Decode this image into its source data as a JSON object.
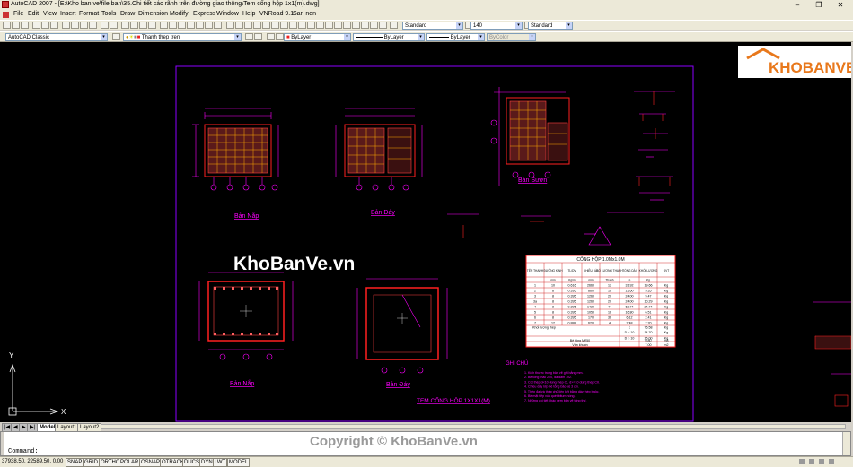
{
  "titlebar": {
    "title": "AutoCAD 2007 - [E:\\Kho ban ve\\file ban\\35.Chi tiết các rãnh trên đường giao thông\\Tem cống hộp 1x1(m).dwg]",
    "minimize_glyph": "–",
    "restore_glyph": "❐",
    "close_glyph": "✕"
  },
  "menubar": {
    "items": [
      "File",
      "Edit",
      "View",
      "Insert",
      "Format",
      "Tools",
      "Draw",
      "Dimension",
      "Modify",
      "Express",
      "Window",
      "Help",
      "VNRoad 9.1",
      "San nen"
    ]
  },
  "toolbar": {
    "text_style": "Standard",
    "dim_scale": "140",
    "dim_style": "Standard",
    "workspace": "AutoCAD Classic",
    "layer": "Thanh thep tren",
    "color": "ByLayer",
    "linetype": "ByLayer",
    "lineweight": "ByLayer",
    "plotstyle": "ByColor"
  },
  "drawing": {
    "views": {
      "top_plan": "Bản Nắp",
      "bottom_plan": "Bản Đáy",
      "wall": "Bản Sườn",
      "cover2": "Bản Nắp",
      "base2": "Bản Đáy"
    },
    "main_title": "TEM CỐNG HỘP 1X1X1(M)",
    "notes_title": "GHI CHÚ",
    "notes": [
      "1. Kích thước trong bản vẽ ghi bằng mm.",
      "2. Bê tông mác 250, đá dăm 1x2.",
      "3. Cốt thép d<10 dùng thép CI, d>=10 dùng thép CII.",
      "4. Chiều dày lớp bê tông bảo vệ 3 cm.",
      "5. Thép đai và thép chủ liên kết bằng dây thép buộc.",
      "6. Bề mặt tiếp xúc quét bitum nóng.",
      "7. Những chi tiết khác xem bản vẽ tổng thể."
    ],
    "table": {
      "title": "CỐNG HỘP 1.0Mx1.0M",
      "headers": [
        "TÊN THANH",
        "ĐƯỜNG KÍNH",
        "TL/DV",
        "CHIỀU DÀI",
        "SỐ LƯỢNG THANH",
        "TỔNG DÀI",
        "KHỐI LƯỢNG",
        "ĐVT"
      ],
      "units": [
        "",
        "mm",
        "Kg/m",
        "mm",
        "Thanh",
        "m",
        "Kg",
        ""
      ],
      "rows": [
        [
          "1",
          "10",
          "0.616",
          "2660",
          "12",
          "31.92",
          "19.66",
          "Kg"
        ],
        [
          "2",
          "8",
          "0.395",
          "860",
          "16",
          "13.60",
          "5.35",
          "Kg"
        ],
        [
          "3",
          "8",
          "0.395",
          "1260",
          "20",
          "24.00",
          "9.47",
          "Kg"
        ],
        [
          "3a",
          "8",
          "0.395",
          "1260",
          "20",
          "24.00",
          "10.29",
          "Kg"
        ],
        [
          "4",
          "8",
          "0.395",
          "1420",
          "44",
          "62.74",
          "24.74",
          "Kg"
        ],
        [
          "5",
          "8",
          "0.395",
          "1050",
          "16",
          "16.80",
          "6.51",
          "Kg"
        ],
        [
          "6",
          "8",
          "0.395",
          "170",
          "36",
          "6.12",
          "2.41",
          "Kg"
        ],
        [
          "7",
          "12",
          "0.888",
          "620",
          "4",
          "2.48",
          "2.20",
          "Kg"
        ]
      ],
      "summary": [
        [
          "Khối lượng thép",
          "",
          "",
          "",
          "",
          "Σ",
          "75.58",
          "Kg"
        ],
        [
          "",
          "",
          "",
          "",
          "",
          "D < 10",
          "14.70",
          "Kg"
        ],
        [
          "",
          "",
          "",
          "",
          "",
          "D > 10",
          "15.00",
          "Kg"
        ],
        [
          "Bê tông M250",
          "",
          "",
          "",
          "",
          "",
          "0.80",
          "m3"
        ],
        [
          "Ván khuôn",
          "",
          "",
          "",
          "",
          "",
          "7.00",
          "m2"
        ]
      ]
    }
  },
  "watermarks": {
    "center": "KhoBanVe.vn",
    "logo": "KHOBANVE",
    "copyright": "Copyright © KhoBanVe.vn"
  },
  "ucs": {
    "x_label": "X",
    "y_label": "Y"
  },
  "tabs": [
    "Model",
    "Layout1",
    "Layout2"
  ],
  "command": {
    "prompt": "Command:"
  },
  "statusbar": {
    "coords": "37938.50, 22589.50, 0.00",
    "toggles": [
      "SNAP",
      "GRID",
      "ORTHO",
      "POLAR",
      "OSNAP",
      "OTRACK",
      "DUCS",
      "DYN",
      "LWT",
      "MODEL"
    ]
  },
  "colors": {
    "canvas_bg": "#000000",
    "frame": "#8c00ff",
    "magenta": "#ff00ff",
    "red": "#ff2020",
    "white": "#ffffff",
    "logo_orange": "#e8781c"
  }
}
